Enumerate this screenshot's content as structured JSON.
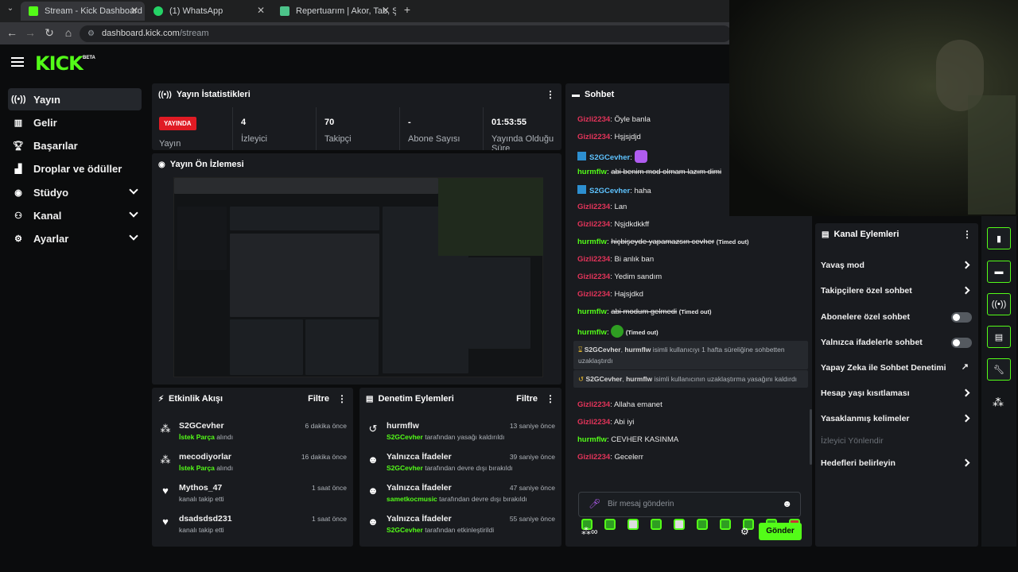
{
  "browser": {
    "tabs": [
      {
        "title": "Stream - Kick Dashboard",
        "active": true,
        "favicon_color": "#53fc18"
      },
      {
        "title": "(1) WhatsApp",
        "active": false,
        "favicon_color": "#25d366"
      },
      {
        "title": "Repertuarım | Akor, Tab, Şarkı S",
        "active": false,
        "favicon_color": "#4cc38a"
      }
    ],
    "url_domain": "dashboard.kick.com",
    "url_path": "/stream"
  },
  "app": {
    "logo": "KICK",
    "logo_badge": "BETA",
    "sidebar": [
      {
        "label": "Yayın",
        "icon": "broadcast-icon",
        "active": true,
        "expandable": false
      },
      {
        "label": "Gelir",
        "icon": "revenue-icon",
        "active": false,
        "expandable": false
      },
      {
        "label": "Başarılar",
        "icon": "trophy-icon",
        "active": false,
        "expandable": false
      },
      {
        "label": "Droplar ve ödüller",
        "icon": "gift-icon",
        "active": false,
        "expandable": false
      },
      {
        "label": "Stüdyo",
        "icon": "studio-icon",
        "active": false,
        "expandable": true
      },
      {
        "label": "Kanal",
        "icon": "channel-icon",
        "active": false,
        "expandable": true
      },
      {
        "label": "Ayarlar",
        "icon": "settings-icon",
        "active": false,
        "expandable": true
      }
    ]
  },
  "stats": {
    "title": "Yayın İstatistikleri",
    "live_badge": "YAYINDA",
    "stream_label": "Yayın",
    "items": [
      {
        "value": "4",
        "label": "İzleyici"
      },
      {
        "value": "70",
        "label": "Takipçi"
      },
      {
        "value": "-",
        "label": "Abone Sayısı"
      },
      {
        "value": "01:53:55",
        "label": "Yayında Olduğu Süre"
      }
    ]
  },
  "preview": {
    "title": "Yayın Ön İzlemesi"
  },
  "activity": {
    "title": "Etkinlik Akışı",
    "filter": "Filtre",
    "events": [
      {
        "user": "S2GCevher",
        "highlight": "İstek Parça",
        "detail": "alındı",
        "time": "6 dakika önce",
        "icon": "redeem-icon"
      },
      {
        "user": "mecodiyorlar",
        "highlight": "İstek Parça",
        "detail": "alındı",
        "time": "16 dakika önce",
        "icon": "redeem-icon"
      },
      {
        "user": "Mythos_47",
        "highlight": "",
        "detail": "kanalı takip etti",
        "time": "1 saat önce",
        "icon": "heart-icon"
      },
      {
        "user": "dsadsdsd231",
        "highlight": "",
        "detail": "kanalı takip etti",
        "time": "1 saat önce",
        "icon": "heart-icon"
      }
    ]
  },
  "moderation": {
    "title": "Denetim Eylemleri",
    "filter": "Filtre",
    "events": [
      {
        "title": "hurmflw",
        "actor": "S2GCevher",
        "detail": "tarafından yasağı kaldırıldı",
        "time": "13 saniye önce",
        "icon": "undo-icon"
      },
      {
        "title": "Yalnızca İfadeler",
        "actor": "S2GCevher",
        "detail": "tarafından devre dışı bırakıldı",
        "time": "39 saniye önce",
        "icon": "emoji-icon"
      },
      {
        "title": "Yalnızca İfadeler",
        "actor": "sametkocmusic",
        "detail": "tarafından devre dışı bırakıldı",
        "time": "47 saniye önce",
        "icon": "emoji-icon"
      },
      {
        "title": "Yalnızca İfadeler",
        "actor": "S2GCevher",
        "detail": "tarafından etkinleştirildi",
        "time": "55 saniye önce",
        "icon": "emoji-icon"
      }
    ]
  },
  "chat": {
    "title": "Sohbet",
    "messages": [
      {
        "user": "Gizli2234",
        "color": "#e4345a",
        "text": "Öyle banla",
        "style": "normal"
      },
      {
        "user": "Gizli2234",
        "color": "#e4345a",
        "text": "Hşjsjdjd",
        "style": "normal"
      },
      {
        "user": "S2GCevher",
        "color": "#5ec3ff",
        "text": "",
        "style": "emote-purple"
      },
      {
        "user": "hurmflw",
        "color": "#53fc18",
        "text": "abi benim mod olmam lazım dimi",
        "style": "strike"
      },
      {
        "user": "S2GCevher",
        "color": "#5ec3ff",
        "text": "haha",
        "style": "normal"
      },
      {
        "user": "Gizli2234",
        "color": "#e4345a",
        "text": "Lan",
        "style": "normal"
      },
      {
        "user": "Gizli2234",
        "color": "#e4345a",
        "text": "Nşjdkdkkff",
        "style": "normal"
      },
      {
        "user": "hurmflw",
        "color": "#53fc18",
        "text": "hiçbişeyde yapamazsın cevher",
        "style": "strike-timeout"
      },
      {
        "user": "Gizli2234",
        "color": "#e4345a",
        "text": "Bi anlık ban",
        "style": "normal"
      },
      {
        "user": "Gizli2234",
        "color": "#e4345a",
        "text": "Yedim sandım",
        "style": "normal"
      },
      {
        "user": "Gizli2234",
        "color": "#e4345a",
        "text": "Hajsjdkd",
        "style": "normal"
      },
      {
        "user": "hurmflw",
        "color": "#53fc18",
        "text": "abi modum gelmedi",
        "style": "strike-timeout"
      },
      {
        "user": "hurmflw",
        "color": "#53fc18",
        "text": "",
        "style": "emote-timeout"
      }
    ],
    "timed_out_label": "(Timed out)",
    "system": [
      {
        "actor": "S2GCevher",
        "target": "hurmflw",
        "text": "isimli kullanıcıyı 1 hafta süreliğine sohbetten uzaklaştırdı",
        "icon": "hourglass-icon"
      },
      {
        "actor": "S2GCevher",
        "target": "hurmflw",
        "text": "isimli kullanıcının uzaklaştırma yasağını kaldırdı",
        "icon": "undo-icon"
      }
    ],
    "messages_after": [
      {
        "user": "Gizli2234",
        "color": "#e4345a",
        "text": "Allaha emanet"
      },
      {
        "user": "Gizli2234",
        "color": "#e4345a",
        "text": "Abi iyi"
      },
      {
        "user": "hurmflw",
        "color": "#53fc18",
        "text": "CEVHER KASINMA"
      },
      {
        "user": "Gizli2234",
        "color": "#e4345a",
        "text": "Gecelerr"
      }
    ],
    "input_placeholder": "Bir mesaj gönderin",
    "send_label": "Gönder"
  },
  "channel_actions": {
    "title": "Kanal Eylemleri",
    "items": [
      {
        "label": "Yavaş mod",
        "control": "arrow"
      },
      {
        "label": "Takipçilere özel sohbet",
        "control": "arrow"
      },
      {
        "label": "Abonelere özel sohbet",
        "control": "toggle"
      },
      {
        "label": "Yalnızca ifadelerle sohbet",
        "control": "toggle"
      },
      {
        "label": "Yapay Zeka ile Sohbet Denetimi",
        "control": "external"
      },
      {
        "label": "Hesap yaşı kısıtlaması",
        "control": "arrow"
      },
      {
        "label": "Yasaklanmış kelimeler",
        "control": "arrow"
      },
      {
        "label": "İzleyici Yönlendir",
        "control": "disabled"
      },
      {
        "label": "Hedefleri belirleyin",
        "control": "arrow"
      }
    ]
  },
  "right_rail": [
    "notes-icon",
    "chat-icon",
    "broadcast-icon",
    "store-icon",
    "wrench-icon",
    "more-icon"
  ],
  "colors": {
    "accent": "#53fc18",
    "live": "#e01b24",
    "panel": "#191b1f",
    "bg": "#0b0c0d"
  }
}
